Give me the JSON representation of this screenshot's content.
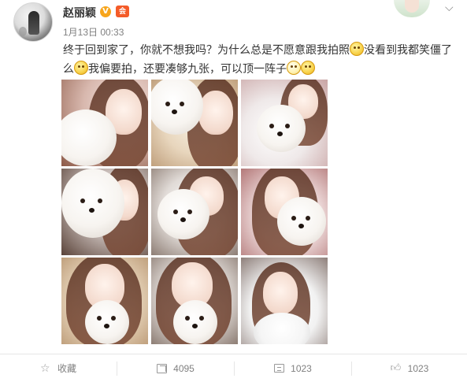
{
  "post": {
    "username": "赵丽颖",
    "verified_badge": "V",
    "vip_badge": "会",
    "timestamp": "1月13日 00:33",
    "text_segments": [
      "终于回到家了，你就不想我吗？为什么总是不愿意跟我拍照",
      "没看到我都笑僵了么",
      "我偏要拍，还要凑够九张，可以顶一阵子"
    ],
    "emoji_names": [
      "smirk-emoji",
      "smirk-emoji",
      "grin-emoji",
      "smirk-emoji"
    ],
    "photos": [
      "photo-1",
      "photo-2",
      "photo-3",
      "photo-4",
      "photo-5",
      "photo-6",
      "photo-7",
      "photo-8",
      "photo-9"
    ]
  },
  "actions": {
    "favorite_label": "收藏",
    "share_count": "4095",
    "comment_count": "1023",
    "like_count": "1023"
  },
  "icons": {
    "favorite": "star-icon",
    "share": "share-icon",
    "comment": "comment-icon",
    "like": "thumbs-up-icon",
    "menu": "chevron-down-icon"
  },
  "colors": {
    "username": "#333333",
    "meta_text": "#808080",
    "verified_badge": "#f7a51c",
    "vip_badge": "#f45b28",
    "divider": "#e6e6e6"
  }
}
